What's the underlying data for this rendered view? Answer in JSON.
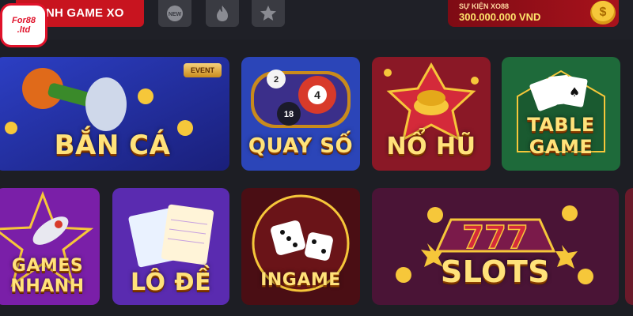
{
  "header": {
    "category_tab": "NH GAME XO",
    "filters": [
      {
        "name": "new",
        "label": "NEW"
      },
      {
        "name": "hot",
        "label": ""
      },
      {
        "name": "favorite",
        "label": ""
      }
    ],
    "event": {
      "label": "SỰ KIỆN XO88",
      "value": "300.000.000 VND"
    }
  },
  "logo": {
    "line1": "For88",
    "line2": ".ltd"
  },
  "games": [
    {
      "title": "BẮN CÁ",
      "tag": "EVENT"
    },
    {
      "title": "QUAY SỐ"
    },
    {
      "title": "NỔ HŨ"
    },
    {
      "title": "TABLE GAME"
    },
    {
      "title": "GAMES NHANH"
    },
    {
      "title": "LÔ ĐỀ"
    },
    {
      "title": "INGAME"
    },
    {
      "title": "SLOTS"
    }
  ],
  "colors": {
    "accent": "#c8141f",
    "background": "#1d1e24",
    "gold": "#ffe27a"
  }
}
